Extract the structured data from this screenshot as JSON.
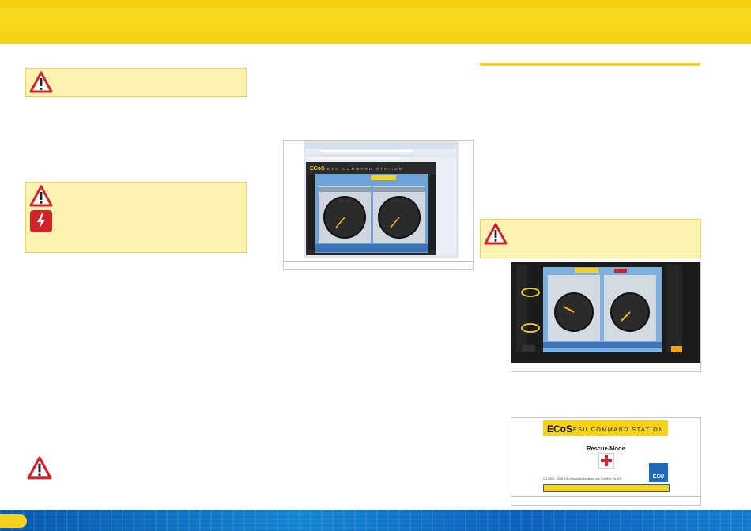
{
  "rescue_window": {
    "brand": "ECoS",
    "brand_subtitle": "ESU COMMAND STATION",
    "mode_label": "Rescue-Mode",
    "copyright": "(C) 2003 - 2009 ESU electronic solutions ulm GmbH & Co. KG",
    "logo_text": "ESU"
  },
  "browser_screen": {
    "brand": "ECoS",
    "brand_subtitle": "ESU COMMAND STATION"
  },
  "icons": [
    "warning-triangle-icon",
    "high-voltage-icon",
    "rescue-cross-icon"
  ],
  "colors": {
    "accent": "#f6d21a",
    "warning_bg": "#fdf3b0",
    "footer_blue": "#0e64c0",
    "warning_red": "#d2232a"
  }
}
